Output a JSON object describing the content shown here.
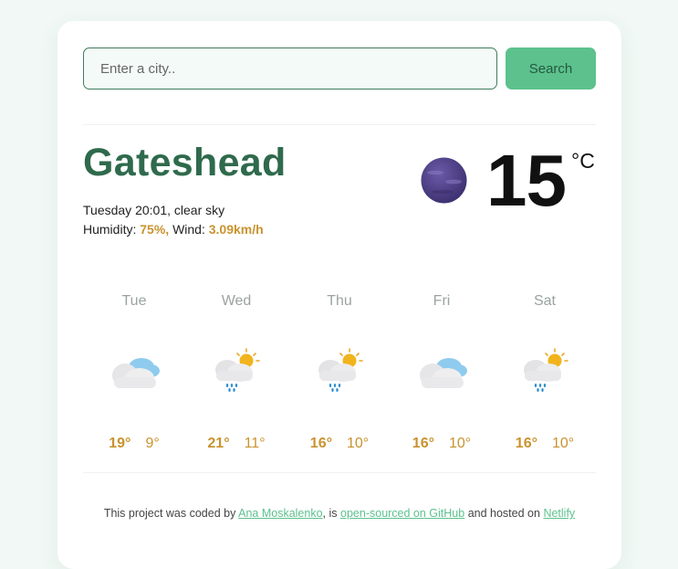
{
  "search": {
    "placeholder": "Enter a city..",
    "value": "",
    "button_label": "Search"
  },
  "current": {
    "city": "Gateshead",
    "datetime": "Tuesday 20:01",
    "description": "clear sky",
    "humidity_label": "Humidity:",
    "humidity": "75%,",
    "wind_label": "Wind:",
    "wind": "3.09km/h",
    "temperature": "15",
    "unit": "°C",
    "icon": "night-clear-moon-icon"
  },
  "forecast": [
    {
      "day": "Tue",
      "max": "19°",
      "min": "9°",
      "icon": "cloudy-icon"
    },
    {
      "day": "Wed",
      "max": "21°",
      "min": "11°",
      "icon": "sun-cloud-rain-icon"
    },
    {
      "day": "Thu",
      "max": "16°",
      "min": "10°",
      "icon": "sun-cloud-rain-icon"
    },
    {
      "day": "Fri",
      "max": "16°",
      "min": "10°",
      "icon": "cloudy-icon"
    },
    {
      "day": "Sat",
      "max": "16°",
      "min": "10°",
      "icon": "sun-cloud-rain-icon"
    }
  ],
  "footer": {
    "prefix": "This project was coded by",
    "author": "Ana Moskalenko",
    "middle": ", is",
    "github": "open-sourced on GitHub",
    "between": "and hosted on",
    "host": "Netlify"
  },
  "colors": {
    "accent_green": "#5cc18d",
    "city_green": "#2f6a4c",
    "temp_gold": "#c9932f"
  }
}
